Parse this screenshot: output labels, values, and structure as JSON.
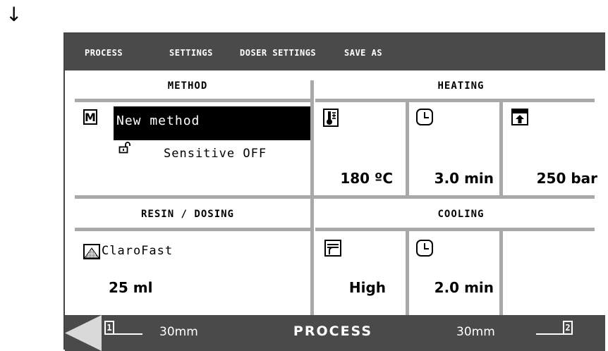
{
  "decor": {
    "arrow": "↓"
  },
  "menu": {
    "process": "PROCESS",
    "settings": "SETTINGS",
    "doser_settings": "DOSER SETTINGS",
    "save_as": "SAVE AS"
  },
  "method": {
    "header": "METHOD",
    "badge": "M",
    "name": "New method",
    "sensitive": "Sensitive OFF"
  },
  "heating": {
    "header": "HEATING",
    "temperature": "180 ºC",
    "time": "3.0 min",
    "pressure": "250 bar"
  },
  "resin": {
    "header": "RESIN / DOSING",
    "name": "ClaroFast",
    "volume": "25 ml"
  },
  "cooling": {
    "header": "COOLING",
    "rate": "High",
    "time": "2.0 min"
  },
  "footer": {
    "left_cylinder": "1",
    "left_size": "30mm",
    "mode": "PROCESS",
    "right_size": "30mm",
    "right_cylinder": "2"
  },
  "colors": {
    "bar": "#4a4a4a",
    "divider": "#a9a9a9",
    "selected": "#000000"
  }
}
